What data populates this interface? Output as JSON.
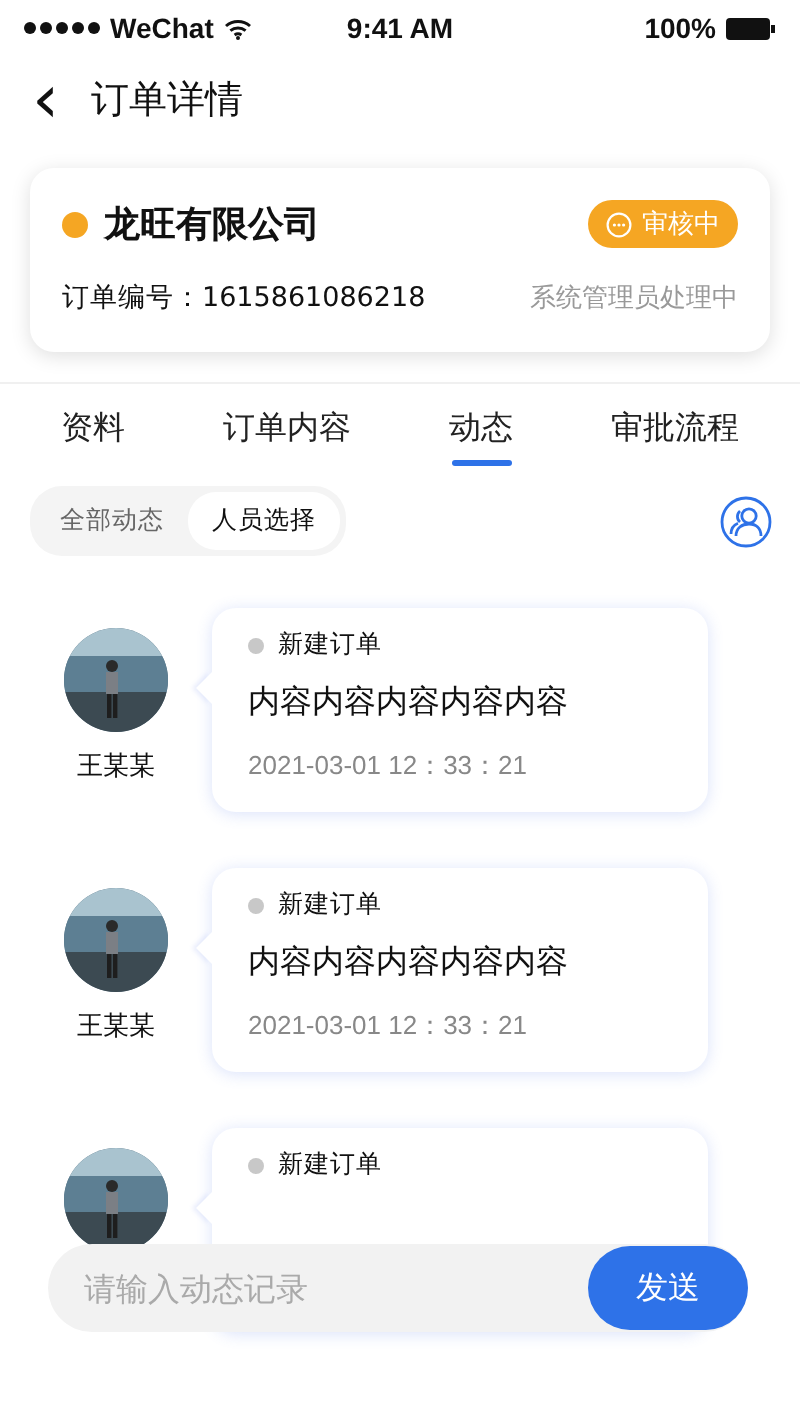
{
  "status_bar": {
    "carrier": "WeChat",
    "time": "9:41 AM",
    "battery": "100%"
  },
  "header": {
    "back": "‹",
    "title": "订单详情"
  },
  "order_card": {
    "company": "龙旺有限公司",
    "badge": "审核中",
    "order_number": "订单编号：1615861086218",
    "handler": "系统管理员处理中"
  },
  "tabs": [
    {
      "label": "资料",
      "selected": false
    },
    {
      "label": "订单内容",
      "selected": false
    },
    {
      "label": "动态",
      "selected": true
    },
    {
      "label": "审批流程",
      "selected": false
    }
  ],
  "filters": [
    {
      "label": "全部动态",
      "selected": false
    },
    {
      "label": "人员选择",
      "selected": true
    }
  ],
  "feed": [
    {
      "name": "王某某",
      "tag": "新建订单",
      "content": "内容内容内容内容内容",
      "time": "2021-03-01   12：33：21"
    },
    {
      "name": "王某某",
      "tag": "新建订单",
      "content": "内容内容内容内容内容",
      "time": "2021-03-01   12：33：21"
    },
    {
      "tag": "新建订单"
    }
  ],
  "composer": {
    "placeholder": "请输入动态记录",
    "send": "发送"
  }
}
